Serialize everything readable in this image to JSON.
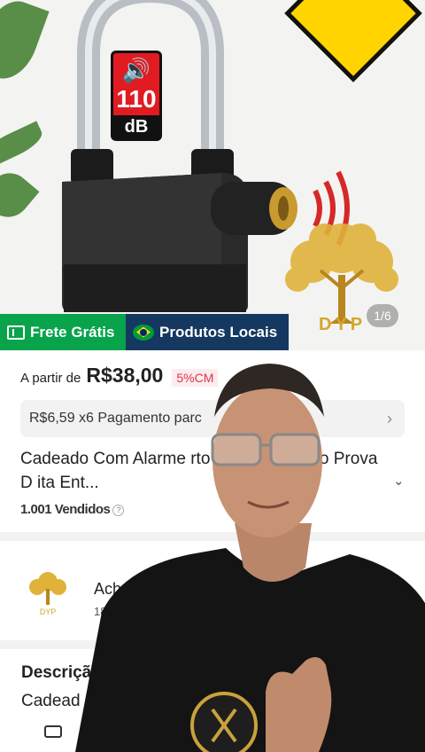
{
  "gallery": {
    "counter": "1/6",
    "badge_number": "110",
    "badge_unit": "dB",
    "brand": "DYP"
  },
  "banner": {
    "frete_label": "Frete Grátis",
    "locais_label": "Produtos Locais"
  },
  "price": {
    "prefix": "A partir de",
    "value": "R$38,00",
    "discount": "5%CM"
  },
  "installment": {
    "text": "R$6,59 x6 Pagamento parc"
  },
  "product": {
    "title": "Cadeado Com Alarme              rto Comércio moto Prova D              ita Ent...",
    "sold": "1.001 Vendidos"
  },
  "store": {
    "name": "Achadinh",
    "sub": "181 Pr",
    "logo_text": "DYP"
  },
  "description": {
    "title": "Descriçã",
    "text": "Cadead                                   Comérc"
  },
  "colors": {
    "frete_green": "#08a34b",
    "locais_navy": "#14385f",
    "badge_red": "#e11b22",
    "warning_yellow": "#ffd400",
    "brand_gold": "#d4a72c"
  }
}
